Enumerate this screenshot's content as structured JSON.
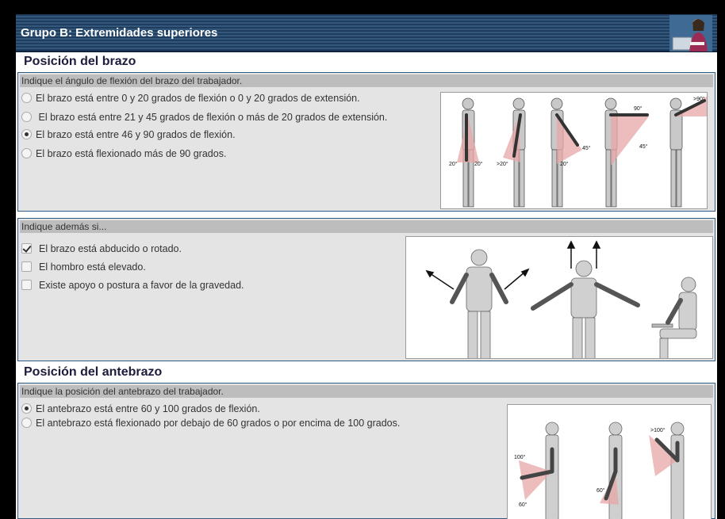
{
  "header": {
    "title": "Grupo B: Extremidades superiores"
  },
  "brazo": {
    "title": "Posición del brazo",
    "question": "Indique el ángulo de flexión del brazo del trabajador.",
    "options": [
      {
        "label": "El brazo está entre 0 y 20 grados de flexión o 0 y 20 grados de extensión.",
        "selected": false
      },
      {
        "label": "El brazo está entre 21 y 45 grados de flexión o más de 20 grados de extensión.",
        "selected": false
      },
      {
        "label": "El brazo está entre 46 y 90 grados de flexión.",
        "selected": true
      },
      {
        "label": "El brazo está flexionado más de 90 grados.",
        "selected": false
      }
    ],
    "figure_labels": [
      "20°",
      "20°",
      ">20°",
      "20°",
      "45°",
      "90°",
      "45°",
      ">90°"
    ]
  },
  "ademas": {
    "question": "Indique además si...",
    "options": [
      {
        "label": "El brazo está abducido o rotado.",
        "checked": true
      },
      {
        "label": "El hombro está elevado.",
        "checked": false
      },
      {
        "label": "Existe apoyo o postura a favor de la gravedad.",
        "checked": false
      }
    ]
  },
  "antebrazo": {
    "title": "Posición del antebrazo",
    "question": "Indique la posición del antebrazo del trabajador.",
    "options": [
      {
        "label": "El antebrazo está entre 60 y 100 grados de flexión.",
        "selected": true
      },
      {
        "label": "El antebrazo está flexionado por debajo de 60 grados o por encima de 100 grados.",
        "selected": false
      }
    ],
    "figure_labels": [
      "100°",
      "60°",
      "60°",
      ">100°"
    ]
  },
  "colors": {
    "header_dark": "#1d3c5e",
    "panel_border": "#2f5a86",
    "panel_bg": "#e4e4e4",
    "bar_bg": "#bdbdbd",
    "title_color": "#1c1c3c"
  }
}
